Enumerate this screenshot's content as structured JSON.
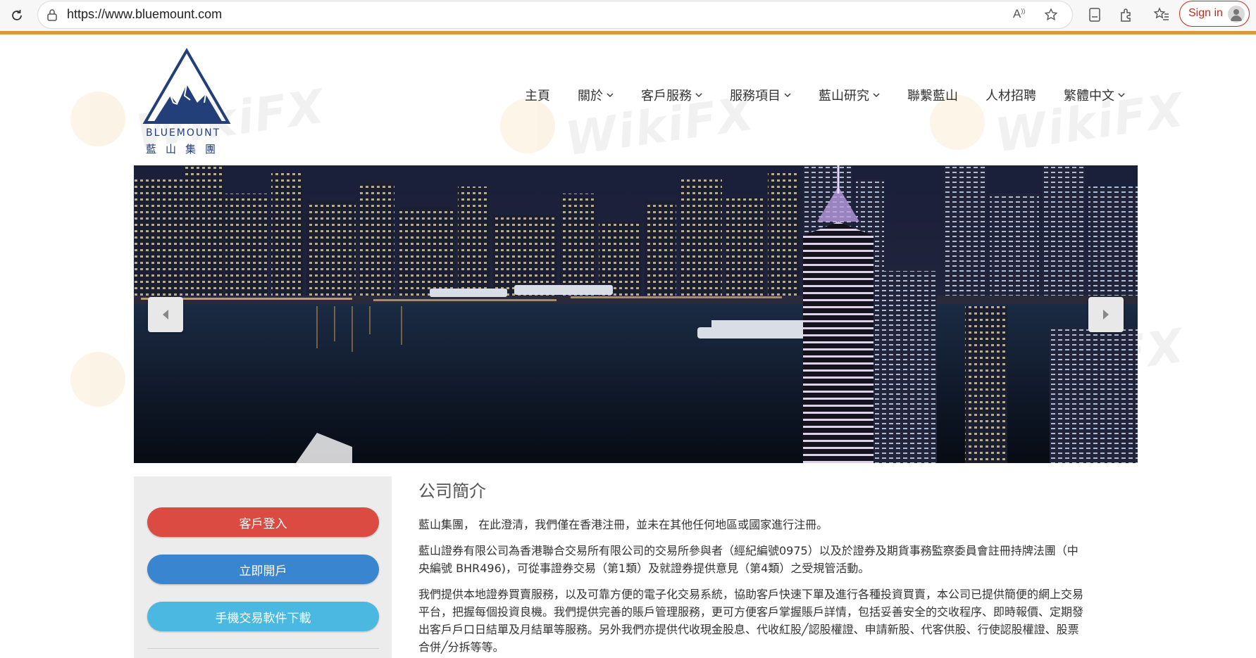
{
  "browser": {
    "url": "https://www.bluemount.com",
    "read_aloud_icon": "read-aloud-icon",
    "sign_in_label": "Sign in"
  },
  "site": {
    "logo_wordmark": "BLUEMOUNT",
    "logo_chinese": "藍山集團"
  },
  "nav": {
    "items": [
      {
        "label": "主頁",
        "has_dropdown": false
      },
      {
        "label": "關於",
        "has_dropdown": true
      },
      {
        "label": "客戶服務",
        "has_dropdown": true
      },
      {
        "label": "服務項目",
        "has_dropdown": true
      },
      {
        "label": "藍山研究",
        "has_dropdown": true
      },
      {
        "label": "聯繫藍山",
        "has_dropdown": false
      },
      {
        "label": "人材招聘",
        "has_dropdown": false
      },
      {
        "label": "繁體中文",
        "has_dropdown": true
      }
    ]
  },
  "sidebar": {
    "buttons": [
      {
        "label": "客戶登入",
        "color": "#dc4b42"
      },
      {
        "label": "立即開戶",
        "color": "#3a85d0"
      },
      {
        "label": "手機交易軟件下載",
        "color": "#4ab8e0"
      }
    ]
  },
  "content": {
    "title": "公司簡介",
    "paragraphs": [
      "藍山集團，  在此澄清，我們僅在香港注冊，並未在其他任何地區或國家進行注冊。",
      "藍山證券有限公司為香港聯合交易所有限公司的交易所參與者（經紀編號0975）以及於證券及期貨事務監察委員會註冊持牌法團（中央編號 BHR496)，可從事證券交易（第1類）及就證券提供意見（第4類）之受規管活動。",
      "我們提供本地證券買賣服務，以及可靠方便的電子化交易系統，協助客戶快速下單及進行各種投資買賣，本公司已提供簡便的網上交易平台，把握每個投資良機。我們提供完善的賬戶管理服務，更可方便客戶掌握賬戶詳情，包括妥善安全的交收程序、即時報價、定期發出客戶戶口日結單及月結單等服務。另外我們亦提供代收現金股息、代收紅股╱認股權證、申請新股、代客供股、行使認股權證、股票合併╱分拆等等。"
    ]
  },
  "watermark": {
    "text": "WikiFX"
  },
  "colors": {
    "brand_navy": "#233f7a",
    "browser_accent": "#d99a3c",
    "sign_in_red": "#c42b1c"
  }
}
